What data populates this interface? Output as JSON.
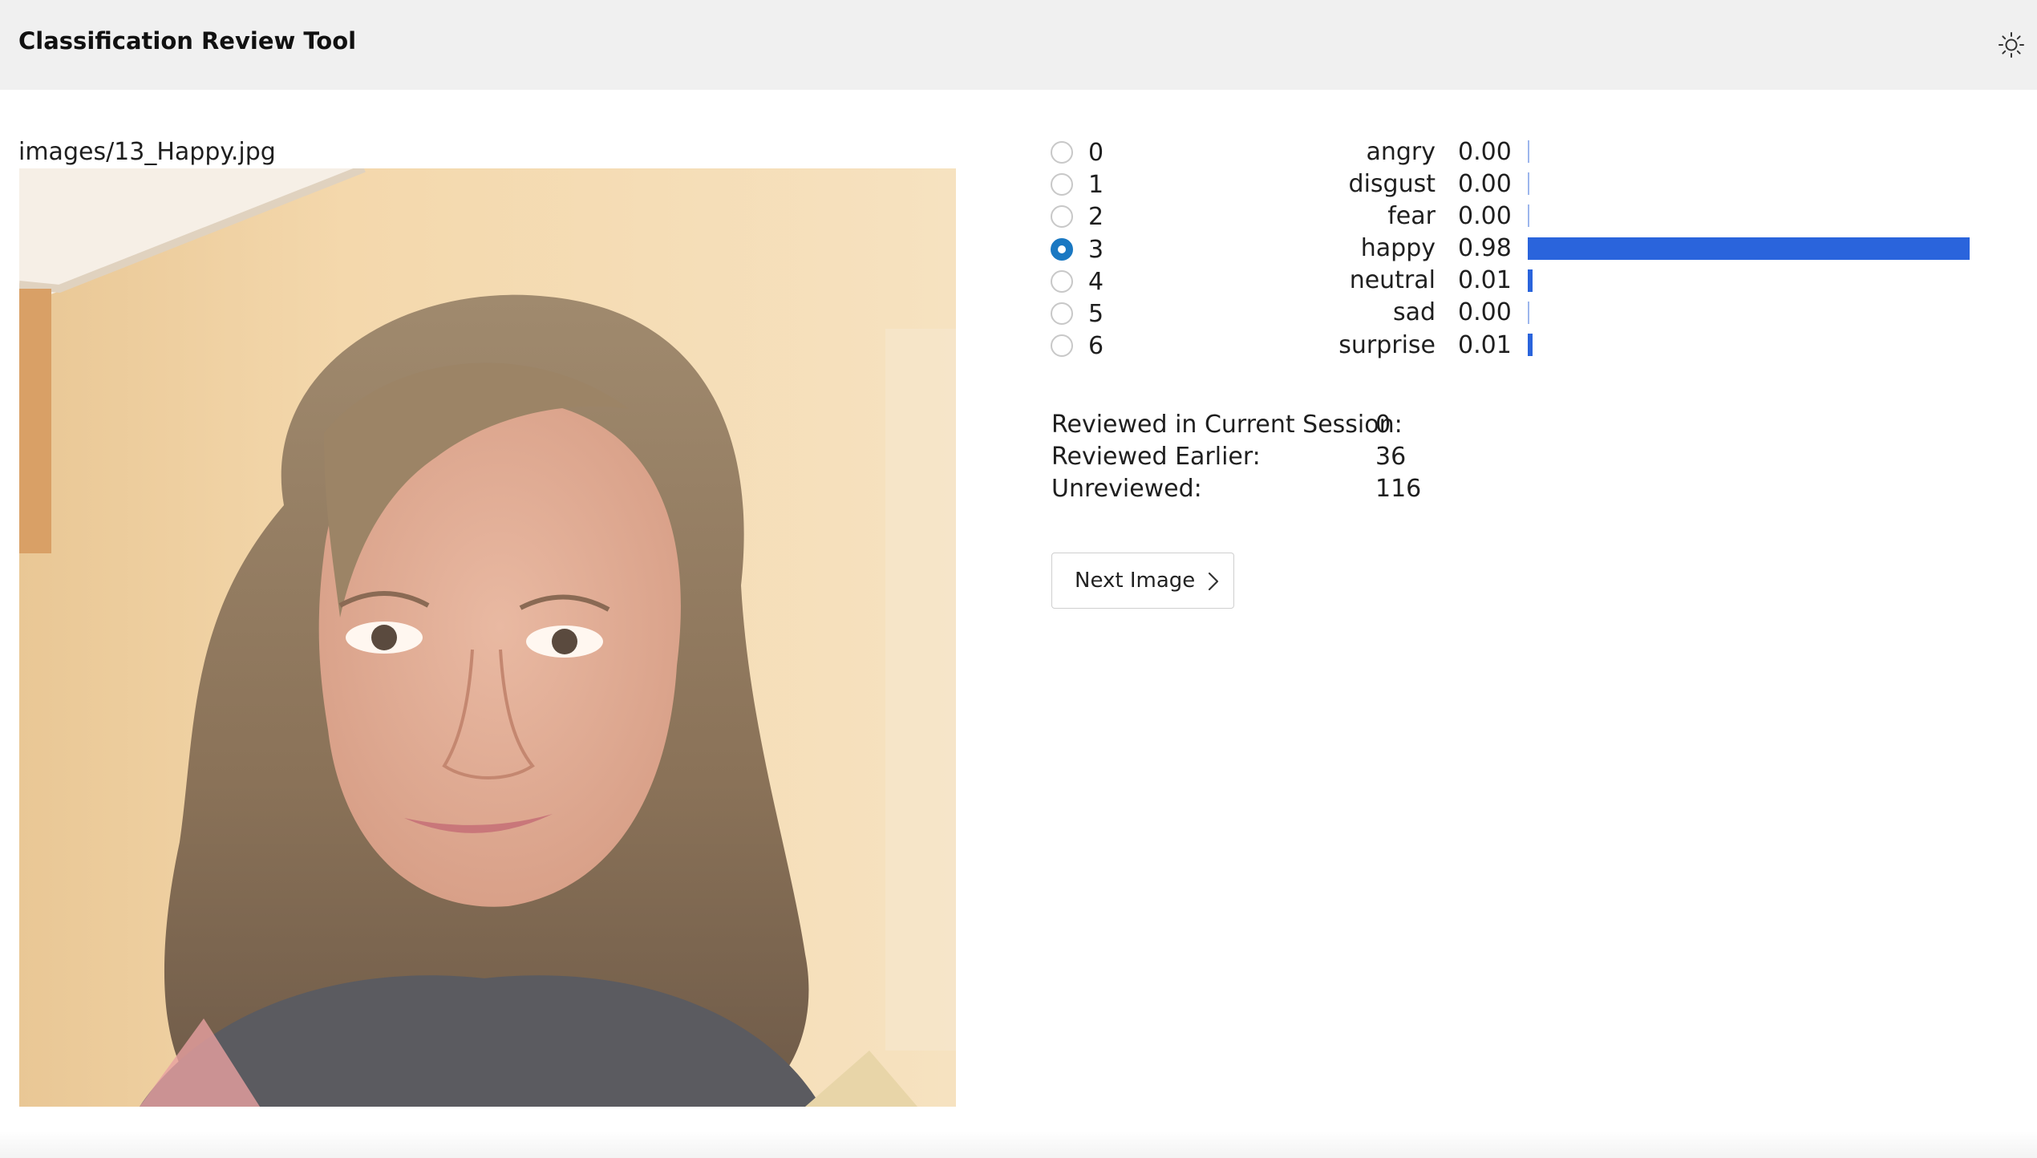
{
  "header": {
    "title": "Classification Review Tool",
    "theme_toggle_icon": "sun-icon"
  },
  "image": {
    "caption": "images/13_Happy.jpg"
  },
  "classes": {
    "options": [
      "0",
      "1",
      "2",
      "3",
      "4",
      "5",
      "6"
    ],
    "selected": "3"
  },
  "probabilities": [
    {
      "label": "angry",
      "value": "0.00",
      "score": 0.0
    },
    {
      "label": "disgust",
      "value": "0.00",
      "score": 0.0
    },
    {
      "label": "fear",
      "value": "0.00",
      "score": 0.0
    },
    {
      "label": "happy",
      "value": "0.98",
      "score": 0.98
    },
    {
      "label": "neutral",
      "value": "0.01",
      "score": 0.01
    },
    {
      "label": "sad",
      "value": "0.00",
      "score": 0.0
    },
    {
      "label": "surprise",
      "value": "0.01",
      "score": 0.01
    }
  ],
  "stats": {
    "current_session_label": "Reviewed in Current Session:",
    "current_session_value": "0",
    "earlier_label": "Reviewed Earlier:",
    "earlier_value": "36",
    "unreviewed_label": "Unreviewed:",
    "unreviewed_value": "116"
  },
  "actions": {
    "next_label": "Next Image",
    "next_icon": "chevron-right-icon"
  },
  "colors": {
    "bar": "#2a64dc",
    "radio_selected": "#1a78c2",
    "header_bg": "#f0f0f0"
  }
}
